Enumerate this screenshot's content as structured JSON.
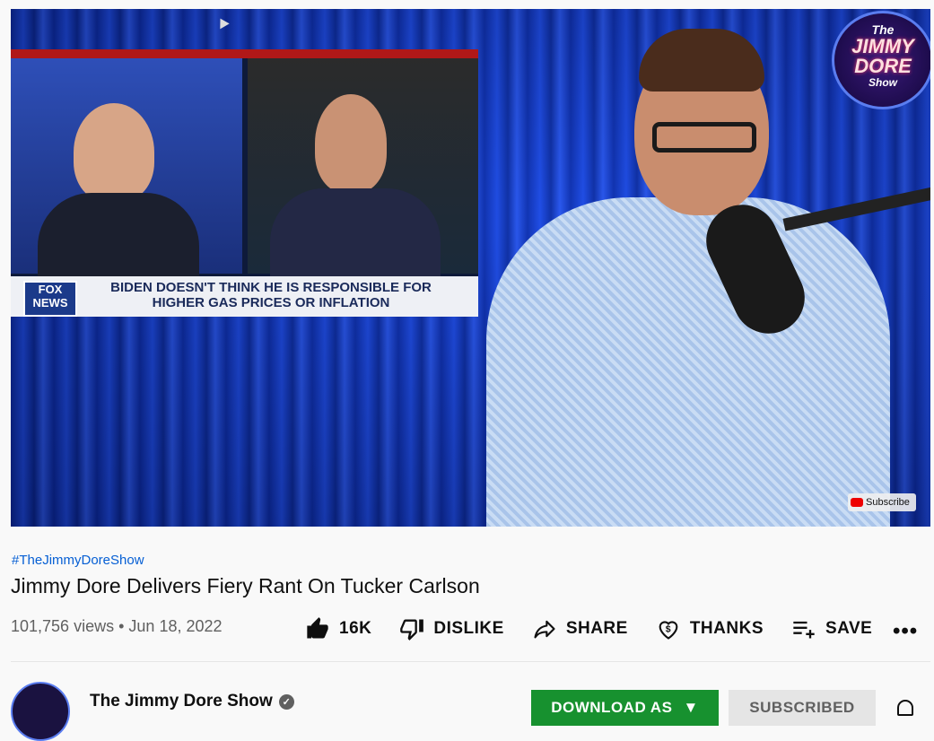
{
  "video": {
    "tv_banner_text": "BIDEN DOESN'T THINK HE IS RESPONSIBLE FOR HIGHER GAS PRICES OR INFLATION",
    "tv_logo": "FOX NEWS",
    "channel_logo": {
      "line1": "The",
      "line2": "JIMMY",
      "line3": "DORE",
      "line4": "Show"
    },
    "subscribe_watermark": "Subscribe"
  },
  "hashtag": "#TheJimmyDoreShow",
  "title": "Jimmy Dore Delivers Fiery Rant On Tucker Carlson",
  "meta": {
    "views": "101,756 views",
    "separator": "•",
    "date": "Jun 18, 2022"
  },
  "actions": {
    "like_count": "16K",
    "dislike_label": "DISLIKE",
    "share_label": "SHARE",
    "thanks_label": "THANKS",
    "save_label": "SAVE",
    "more_label": "•••"
  },
  "channel": {
    "name": "The Jimmy Dore Show",
    "verified_mark": "✓",
    "download_label": "DOWNLOAD AS",
    "subscribed_label": "SUBSCRIBED"
  },
  "icons": {
    "like": "thumbs-up-icon",
    "dislike": "thumbs-down-icon",
    "share": "share-arrow-icon",
    "thanks": "heart-dollar-icon",
    "save": "playlist-add-icon",
    "bell": "bell-icon"
  },
  "colors": {
    "link": "#065fd4",
    "download": "#17912f",
    "subscribed_bg": "#e5e5e5"
  }
}
